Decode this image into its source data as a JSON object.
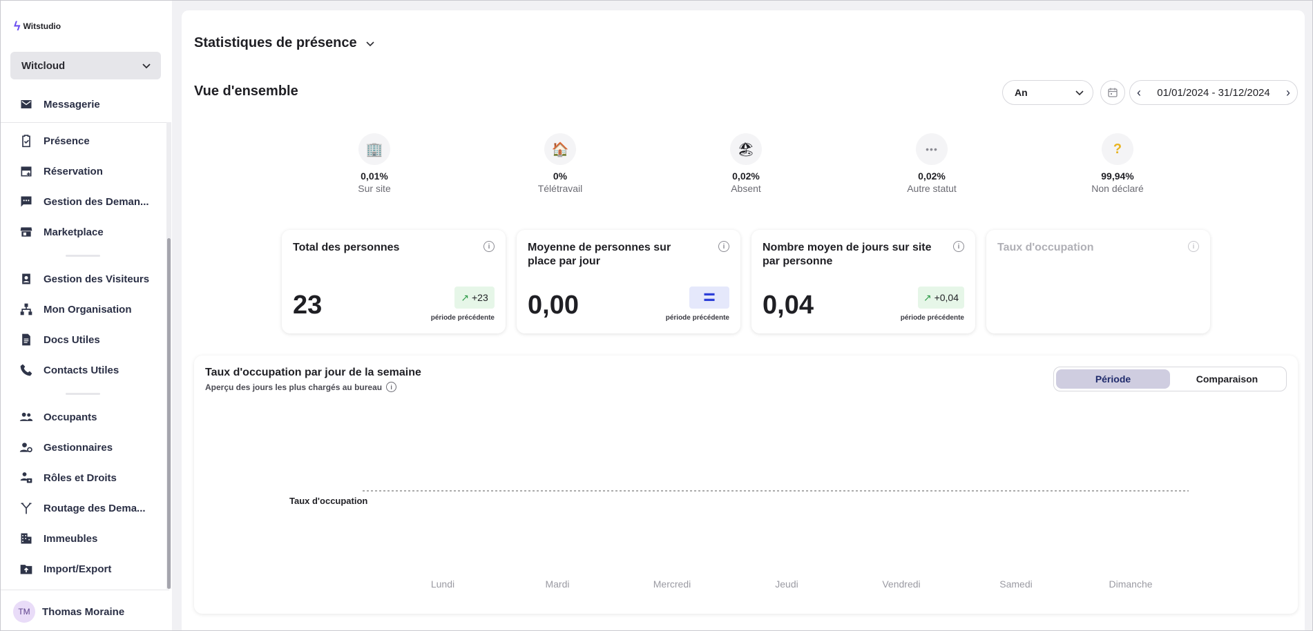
{
  "brand": {
    "name": "Witstudio"
  },
  "workspace": {
    "name": "Witcloud"
  },
  "sidebar": {
    "items": [
      {
        "label": "Messagerie",
        "icon": "mail-icon"
      },
      {
        "label": "Présence",
        "icon": "clipboard-check-icon"
      },
      {
        "label": "Réservation",
        "icon": "calendar-add-icon"
      },
      {
        "label": "Gestion des Deman...",
        "icon": "chat-dots-icon"
      },
      {
        "label": "Marketplace",
        "icon": "store-icon"
      },
      {
        "label": "Gestion des Visiteurs",
        "icon": "visitor-badge-icon"
      },
      {
        "label": "Mon Organisation",
        "icon": "org-chart-icon"
      },
      {
        "label": "Docs Utiles",
        "icon": "document-icon"
      },
      {
        "label": "Contacts Utiles",
        "icon": "phone-icon"
      },
      {
        "label": "Occupants",
        "icon": "people-icon"
      },
      {
        "label": "Gestionnaires",
        "icon": "user-gear-icon"
      },
      {
        "label": "Rôles et Droits",
        "icon": "roles-icon"
      },
      {
        "label": "Routage des Dema...",
        "icon": "routing-icon"
      },
      {
        "label": "Immeubles",
        "icon": "building-icon"
      },
      {
        "label": "Import/Export",
        "icon": "folder-upload-icon"
      }
    ]
  },
  "user": {
    "initials": "TM",
    "name": "Thomas Moraine"
  },
  "header": {
    "title": "Statistiques de présence"
  },
  "overview": {
    "title": "Vue d'ensemble",
    "period": "An",
    "date_range": "01/01/2024 - 31/12/2024"
  },
  "statuses": [
    {
      "pct": "0,01%",
      "label": "Sur site",
      "icon": "office-building-icon",
      "glyph": "🏢"
    },
    {
      "pct": "0%",
      "label": "Télétravail",
      "icon": "house-icon",
      "glyph": "🏠"
    },
    {
      "pct": "0,02%",
      "label": "Absent",
      "icon": "beach-icon",
      "glyph": "🏖"
    },
    {
      "pct": "0,02%",
      "label": "Autre statut",
      "icon": "more-dots-icon",
      "glyph": "•••"
    },
    {
      "pct": "99,94%",
      "label": "Non déclaré",
      "icon": "question-icon",
      "glyph": "?"
    }
  ],
  "cards": [
    {
      "title": "Total des personnes",
      "value": "23",
      "badge": "+23",
      "trend": "up",
      "prev": "période précédente"
    },
    {
      "title": "Moyenne de personnes sur place par jour",
      "value": "0,00",
      "badge": "=",
      "trend": "equal",
      "prev": "période précédente"
    },
    {
      "title": "Nombre moyen de jours sur site par personne",
      "value": "0,04",
      "badge": "+0,04",
      "trend": "up",
      "prev": "période précédente"
    },
    {
      "title": "Taux d'occupation",
      "value": "",
      "badge": "",
      "trend": "none",
      "prev": ""
    }
  ],
  "chart_panel": {
    "title": "Taux d'occupation par jour de la semaine",
    "subtitle": "Aperçu des jours les plus chargés au bureau",
    "toggle": {
      "options": [
        "Période",
        "Comparaison"
      ],
      "active": "Période"
    }
  },
  "chart_data": {
    "type": "bar",
    "categories": [
      "Lundi",
      "Mardi",
      "Mercredi",
      "Jeudi",
      "Vendredi",
      "Samedi",
      "Dimanche"
    ],
    "values": [
      0,
      0,
      0,
      0,
      0,
      0,
      0
    ],
    "reference_line": {
      "label": "Taux d'occupation",
      "style": "dashed"
    },
    "grid": false,
    "legend": "none",
    "colors": {
      "reference": "#555555",
      "tick": "#9a9aa2"
    }
  }
}
